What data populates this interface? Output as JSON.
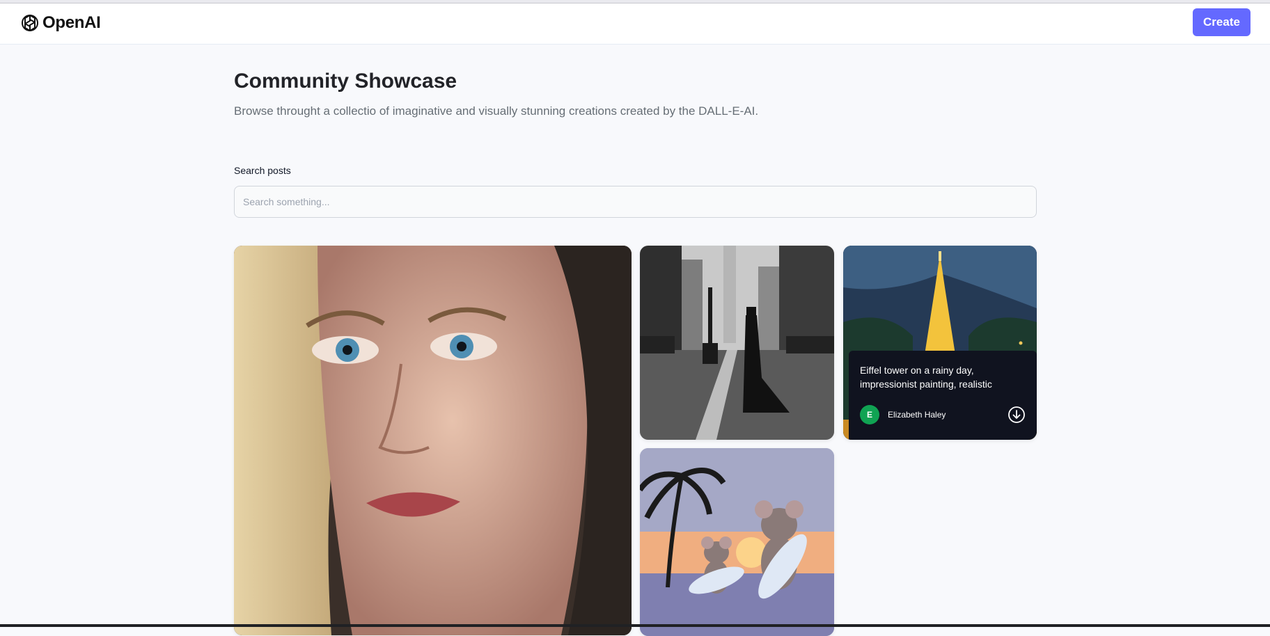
{
  "header": {
    "brand": "OpenAI",
    "create_label": "Create",
    "accent_color": "#6469ff"
  },
  "main": {
    "title": "Community Showcase",
    "subtitle": "Browse throught a collectio of imaginative and visually stunning creations created by the DALL-E-AI.",
    "search": {
      "label": "Search posts",
      "placeholder": "Search something...",
      "value": ""
    }
  },
  "posts": [
    {
      "name": "portrait"
    },
    {
      "name": "city-street"
    },
    {
      "name": "eiffel-tower",
      "prompt": "Eiffel tower on a rainy day, impressionist painting, realistic",
      "author": "Elizabeth Haley",
      "author_initial": "E",
      "avatar_color": "#10a353",
      "download_icon": "download-icon"
    },
    {
      "name": "surfing-mice"
    }
  ]
}
